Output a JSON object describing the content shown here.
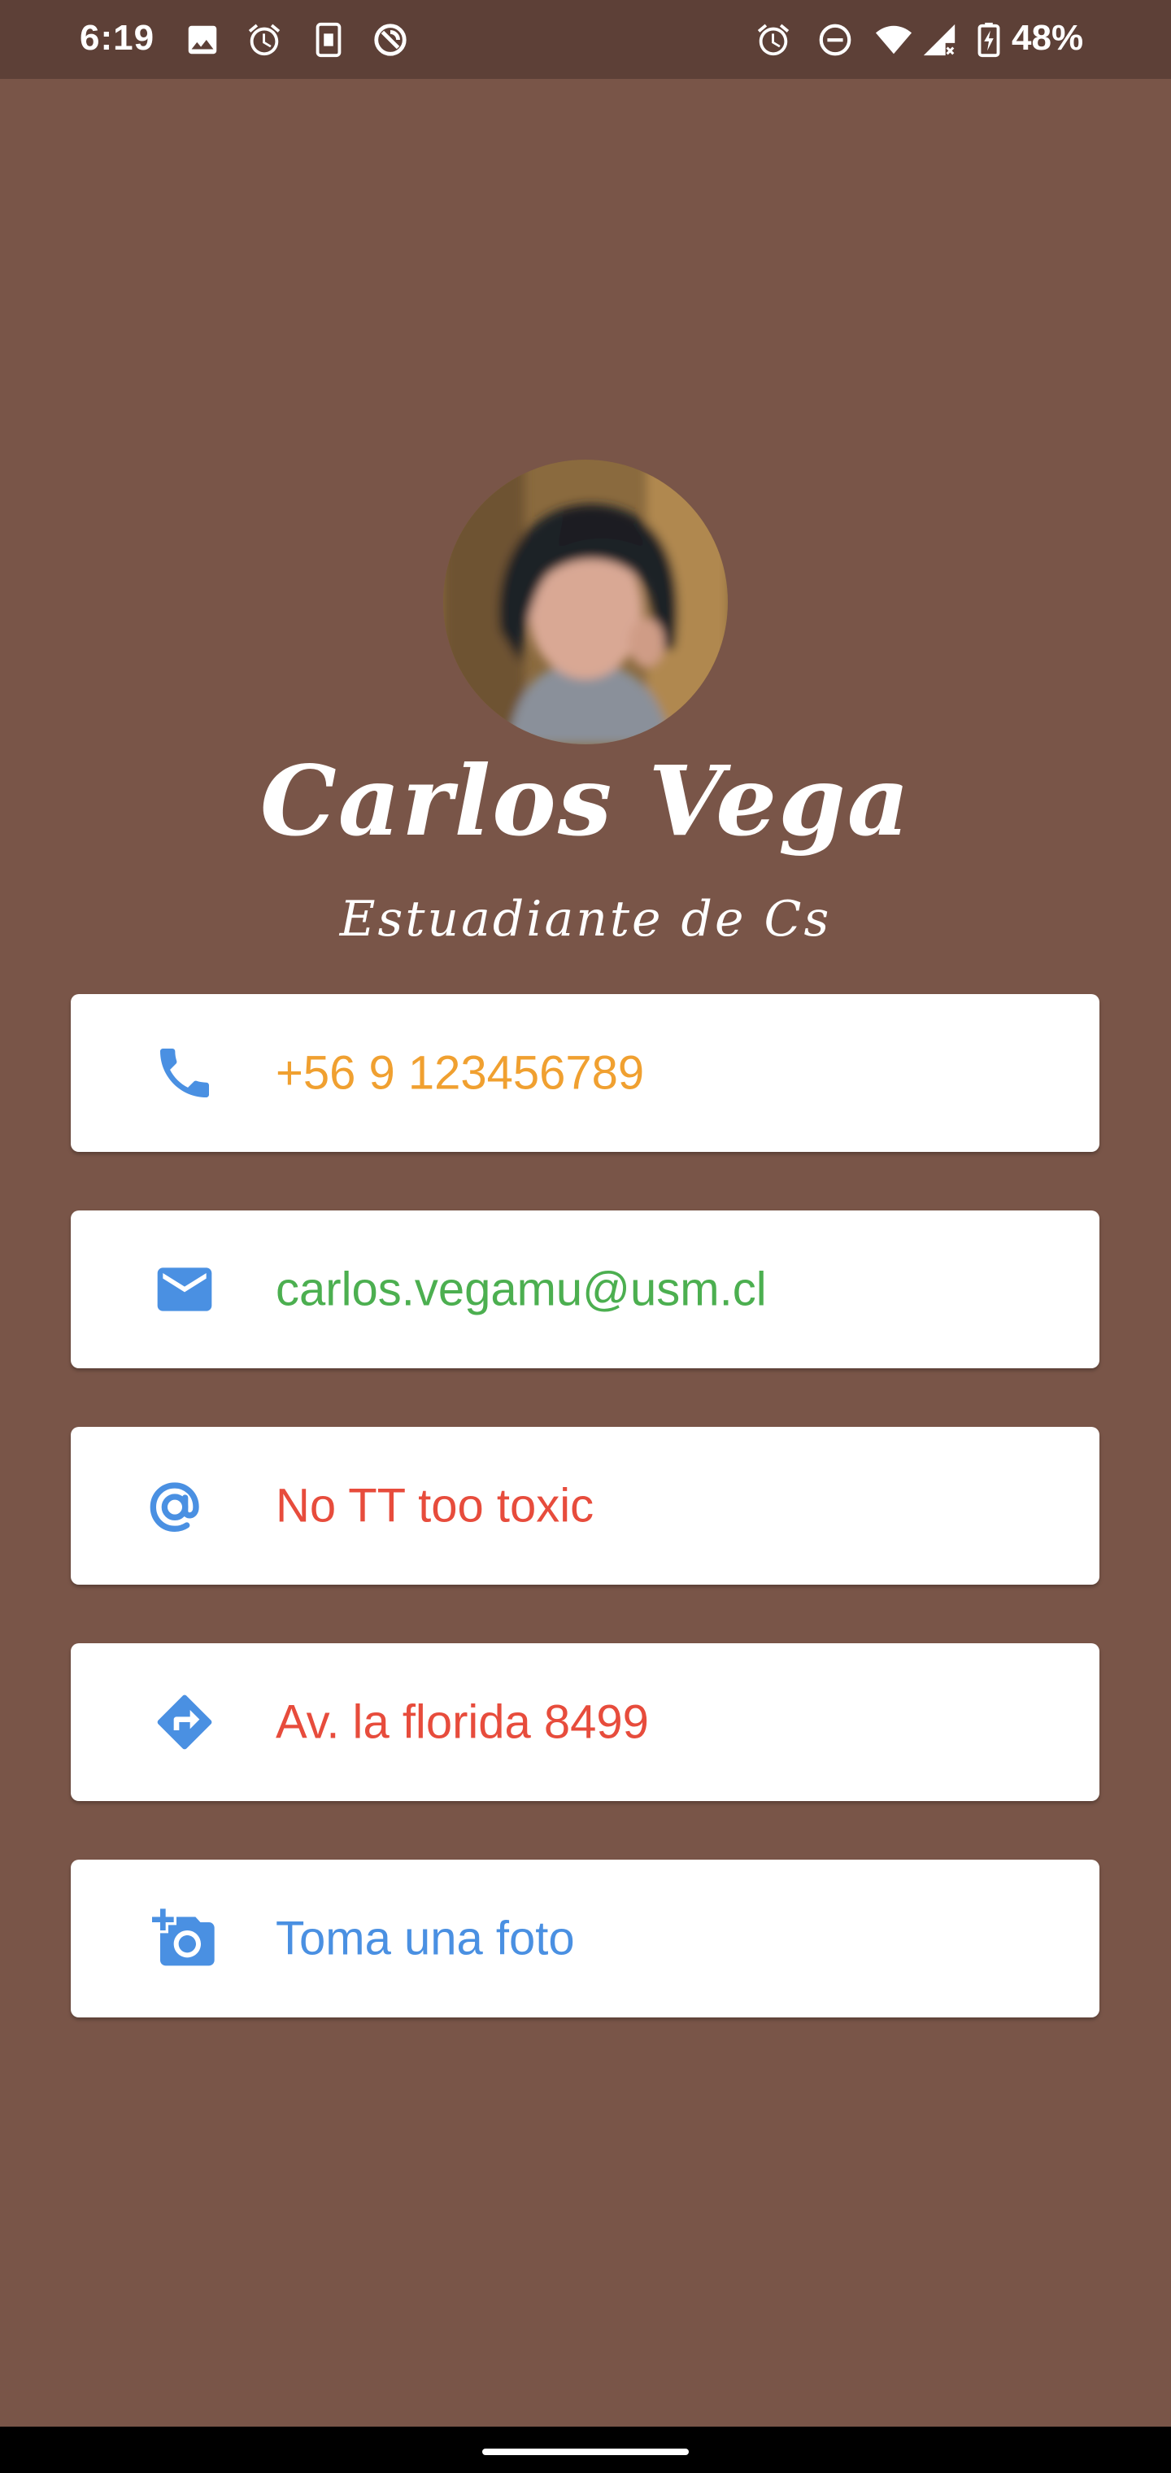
{
  "status_bar": {
    "time": "6:19",
    "battery": "48%",
    "icons_left": [
      "image-icon",
      "alarm-icon",
      "sim-icon",
      "vpn-icon"
    ],
    "icons_right": [
      "alarm-icon",
      "dnd-icon",
      "wifi-icon",
      "signal-icon",
      "battery-charging-icon"
    ]
  },
  "profile": {
    "name": "Carlos Vega",
    "subtitle": "Estuadiante de Cs"
  },
  "cards": [
    {
      "icon": "phone-icon",
      "text": "+56 9 123456789",
      "color": "#F0A030"
    },
    {
      "icon": "email-icon",
      "text": "carlos.vegamu@usm.cl",
      "color": "#4CAF50"
    },
    {
      "icon": "at-icon",
      "text": "No TT too toxic",
      "color": "#E74C3C"
    },
    {
      "icon": "directions-icon",
      "text": "Av. la florida 8499",
      "color": "#E74C3C"
    },
    {
      "icon": "add-photo-icon",
      "text": "Toma una foto",
      "color": "#4A90E2"
    }
  ],
  "colors": {
    "background": "#795548",
    "status_bar": "#5D4037",
    "icon_blue": "#4A90E2"
  }
}
